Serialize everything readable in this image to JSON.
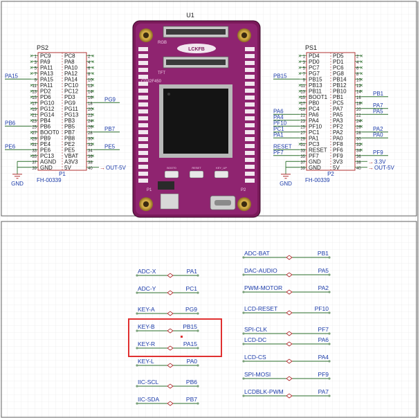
{
  "colors": {
    "wire": "#2a6e2a",
    "net": "#1a3aa8",
    "symbol": "#b03030",
    "pin": "#1a1a1a",
    "board": "#7a1a5a",
    "highlight": "#e03030"
  },
  "module": {
    "ref": "U1",
    "label_rgb": "RGB",
    "label_tft": "TFT",
    "chip": "CD32F450",
    "logo": "LCKFB",
    "p1": "P1",
    "p2": "P2",
    "buttons": [
      "BOOT0",
      "RESET",
      "KEY_UP"
    ]
  },
  "ps2": {
    "ref": "PS2",
    "part": "FH-00339",
    "sub": "P1",
    "rows": [
      {
        "n1": "1",
        "l": "PC9",
        "r": "PC8",
        "n2": "2"
      },
      {
        "n1": "3",
        "l": "PA9",
        "r": "PA8",
        "n2": "4"
      },
      {
        "n1": "5",
        "l": "PA11",
        "r": "PA10",
        "n2": "6"
      },
      {
        "n1": "7",
        "l": "PA13",
        "r": "PA12",
        "n2": "8"
      },
      {
        "n1": "9",
        "l": "PA15",
        "r": "PA14",
        "n2": "10"
      },
      {
        "n1": "11",
        "l": "PA11",
        "r": "PC10",
        "n2": "12"
      },
      {
        "n1": "13",
        "l": "PD2",
        "r": "PC12",
        "n2": "14"
      },
      {
        "n1": "15",
        "l": "PD6",
        "r": "PD3",
        "n2": "16"
      },
      {
        "n1": "17",
        "l": "PG10",
        "r": "PG9",
        "n2": "18"
      },
      {
        "n1": "19",
        "l": "PG12",
        "r": "PG11",
        "n2": "20"
      },
      {
        "n1": "21",
        "l": "PG14",
        "r": "PG13",
        "n2": "22"
      },
      {
        "n1": "23",
        "l": "PB4",
        "r": "PB3",
        "n2": "24"
      },
      {
        "n1": "25",
        "l": "PB6",
        "r": "PB5",
        "n2": "26"
      },
      {
        "n1": "27",
        "l": "BOOT0",
        "r": "PB7",
        "n2": "28"
      },
      {
        "n1": "29",
        "l": "PB9",
        "r": "PB8",
        "n2": "30"
      },
      {
        "n1": "31",
        "l": "PE4",
        "r": "PE2",
        "n2": "32"
      },
      {
        "n1": "33",
        "l": "PE6",
        "r": "PE5",
        "n2": "34"
      },
      {
        "n1": "35",
        "l": "PC13",
        "r": "VBAT",
        "n2": "36"
      },
      {
        "n1": "37",
        "l": "AGND",
        "r": "A3V3",
        "n2": "38"
      },
      {
        "n1": "39",
        "l": "GND",
        "r": "5V",
        "n2": "40"
      }
    ],
    "left_nets": [
      {
        "row": 4,
        "label": "PA15"
      },
      {
        "row": 12,
        "label": "PB6"
      },
      {
        "row": 16,
        "label": "PE6"
      }
    ],
    "right_nets": [
      {
        "row": 8,
        "label": "PG9"
      },
      {
        "row": 13,
        "label": "PB7"
      },
      {
        "row": 16,
        "label": "PE5"
      }
    ],
    "gnd": "GND",
    "out": "OUT-5V"
  },
  "ps1": {
    "ref": "PS1",
    "part": "FH-00339",
    "sub": "P2",
    "rows": [
      {
        "n1": "1",
        "l": "PD4",
        "r": "PD5",
        "n2": "2"
      },
      {
        "n1": "3",
        "l": "PD0",
        "r": "PD1",
        "n2": "4"
      },
      {
        "n1": "5",
        "l": "PC7",
        "r": "PC6",
        "n2": "6"
      },
      {
        "n1": "7",
        "l": "PG7",
        "r": "PG8",
        "n2": "8"
      },
      {
        "n1": "9",
        "l": "PB15",
        "r": "PB14",
        "n2": "10"
      },
      {
        "n1": "11",
        "l": "PB13",
        "r": "PB12",
        "n2": "12"
      },
      {
        "n1": "13",
        "l": "PB11",
        "r": "PB10",
        "n2": "14"
      },
      {
        "n1": "15",
        "l": "BOOT1",
        "r": "PB1",
        "n2": "16"
      },
      {
        "n1": "17",
        "l": "PB0",
        "r": "PC5",
        "n2": "18"
      },
      {
        "n1": "19",
        "l": "PC4",
        "r": "PA7",
        "n2": "20"
      },
      {
        "n1": "21",
        "l": "PA6",
        "r": "PA5",
        "n2": "22"
      },
      {
        "n1": "23",
        "l": "PA4",
        "r": "PA3",
        "n2": "24"
      },
      {
        "n1": "25",
        "l": "PF10",
        "r": "PF2",
        "n2": "26"
      },
      {
        "n1": "27",
        "l": "PC1",
        "r": "PA2",
        "n2": "28"
      },
      {
        "n1": "29",
        "l": "PA1",
        "r": "PA0",
        "n2": "30"
      },
      {
        "n1": "31",
        "l": "PC3",
        "r": "PF8",
        "n2": "32"
      },
      {
        "n1": "33",
        "l": "RESET",
        "r": "PF6",
        "n2": "34"
      },
      {
        "n1": "35",
        "l": "PF7",
        "r": "PF9",
        "n2": "36"
      },
      {
        "n1": "37",
        "l": "GND",
        "r": "3V3",
        "n2": "38"
      },
      {
        "n1": "39",
        "l": "GND",
        "r": "5V",
        "n2": "40"
      }
    ],
    "left_nets": [
      {
        "row": 4,
        "label": "PB15"
      },
      {
        "row": 10,
        "label": "PA6"
      },
      {
        "row": 11,
        "label": "PA4"
      },
      {
        "row": 12,
        "label": "PF10"
      },
      {
        "row": 13,
        "label": "PC1"
      },
      {
        "row": 14,
        "label": "PA1"
      },
      {
        "row": 16,
        "label": "RESET"
      },
      {
        "row": 17,
        "label": "PF7"
      }
    ],
    "right_nets": [
      {
        "row": 7,
        "label": "PB1"
      },
      {
        "row": 9,
        "label": "PA7"
      },
      {
        "row": 10,
        "label": "PA5"
      },
      {
        "row": 13,
        "label": "PA2"
      },
      {
        "row": 14,
        "label": "PA0"
      },
      {
        "row": 17,
        "label": "PF9"
      }
    ],
    "gnd": "GND",
    "v33": "3.3V",
    "out": "OUT-5V"
  },
  "aliases_left": [
    {
      "name": "ADC-X",
      "net": "PA1"
    },
    {
      "name": "ADC-Y",
      "net": "PC1"
    },
    {
      "name": "KEY-A",
      "net": "PG9"
    },
    {
      "name": "KEY-B",
      "net": "PB15"
    },
    {
      "name": "KEY-R",
      "net": "PA15"
    },
    {
      "name": "KEY-L",
      "net": "PA0"
    },
    {
      "name": "IIC-SCL",
      "net": "PB6"
    },
    {
      "name": "IIC-SDA",
      "net": "PB7"
    }
  ],
  "aliases_right": [
    {
      "name": "ADC-BAT",
      "net": "PB1"
    },
    {
      "name": "DAC-AUDIO",
      "net": "PA5"
    },
    {
      "name": "PWM-MOTOR",
      "net": "PA2"
    },
    {
      "name": "LCD-RESET",
      "net": "PF10"
    },
    {
      "name": "SPI-CLK",
      "net": "PF7"
    },
    {
      "name": "LCD-DC",
      "net": "PA6"
    },
    {
      "name": "LCD-CS",
      "net": "PA4"
    },
    {
      "name": "SPI-MOSI",
      "net": "PF9"
    },
    {
      "name": "LCDBLK-PWM",
      "net": "PA7"
    }
  ]
}
